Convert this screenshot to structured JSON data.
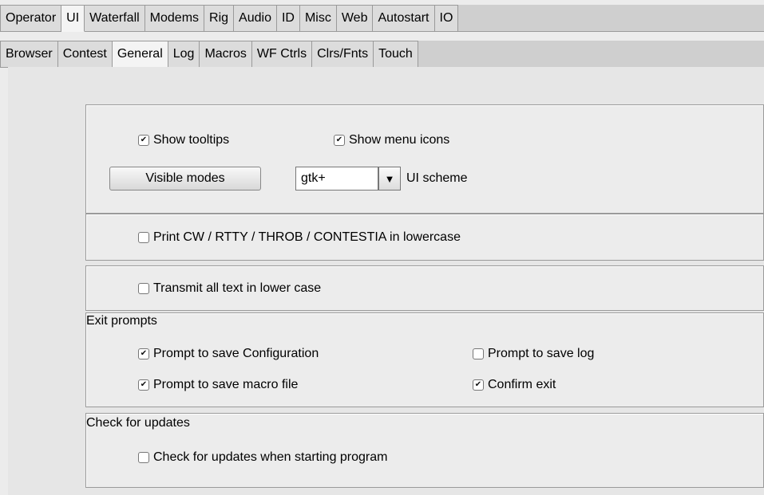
{
  "tabs_row1": [
    {
      "label": "Operator",
      "active": false
    },
    {
      "label": "UI",
      "active": true
    },
    {
      "label": "Waterfall",
      "active": false
    },
    {
      "label": "Modems",
      "active": false
    },
    {
      "label": "Rig",
      "active": false
    },
    {
      "label": "Audio",
      "active": false
    },
    {
      "label": "ID",
      "active": false
    },
    {
      "label": "Misc",
      "active": false
    },
    {
      "label": "Web",
      "active": false
    },
    {
      "label": "Autostart",
      "active": false
    },
    {
      "label": "IO",
      "active": false
    }
  ],
  "tabs_row2": [
    {
      "label": "Browser",
      "active": false
    },
    {
      "label": "Contest",
      "active": false
    },
    {
      "label": "General",
      "active": true
    },
    {
      "label": "Log",
      "active": false
    },
    {
      "label": "Macros",
      "active": false
    },
    {
      "label": "WF Ctrls",
      "active": false
    },
    {
      "label": "Clrs/Fnts",
      "active": false
    },
    {
      "label": "Touch",
      "active": false
    }
  ],
  "general": {
    "show_tooltips": {
      "label": "Show tooltips",
      "checked": true
    },
    "show_menu_icons": {
      "label": "Show menu icons",
      "checked": true
    },
    "visible_modes_button": "Visible modes",
    "ui_scheme": {
      "value": "gtk+",
      "label": "UI scheme",
      "arrow_icon": "triangle-down-icon"
    }
  },
  "lowercase_print": {
    "label": "Print CW / RTTY / THROB / CONTESTIA in lowercase",
    "checked": false
  },
  "lowercase_transmit": {
    "label": "Transmit all text in lower case",
    "checked": false
  },
  "exit_prompts": {
    "title": "Exit prompts",
    "save_config": {
      "label": "Prompt to save Configuration",
      "checked": true
    },
    "save_log": {
      "label": "Prompt to save log",
      "checked": false
    },
    "save_macro": {
      "label": "Prompt to save macro file",
      "checked": true
    },
    "confirm_exit": {
      "label": "Confirm exit",
      "checked": true
    }
  },
  "updates": {
    "title": "Check for updates",
    "check_on_start": {
      "label": "Check for updates when starting program",
      "checked": false
    }
  },
  "check_glyph": "✔"
}
